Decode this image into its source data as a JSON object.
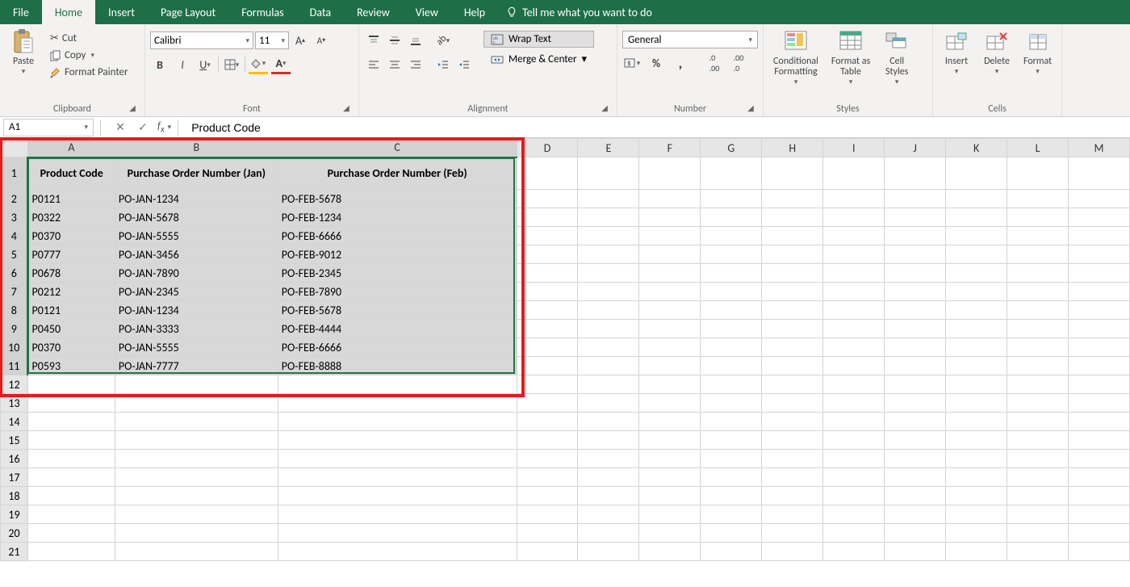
{
  "tabs": {
    "file": "File",
    "home": "Home",
    "insert": "Insert",
    "page_layout": "Page Layout",
    "formulas": "Formulas",
    "data": "Data",
    "review": "Review",
    "view": "View",
    "help": "Help",
    "tell_me": "Tell me what you want to do"
  },
  "clipboard": {
    "paste": "Paste",
    "cut": "Cut",
    "copy": "Copy",
    "format_painter": "Format Painter",
    "group": "Clipboard"
  },
  "font": {
    "name": "Calibri",
    "size": "11",
    "group": "Font"
  },
  "alignment": {
    "wrap": "Wrap Text",
    "merge": "Merge & Center",
    "group": "Alignment"
  },
  "number": {
    "format": "General",
    "group": "Number"
  },
  "styles": {
    "cond": "Conditional\nFormatting",
    "table": "Format as\nTable",
    "cell": "Cell\nStyles",
    "group": "Styles"
  },
  "cells": {
    "insert": "Insert",
    "delete": "Delete",
    "format": "Format",
    "group": "Cells"
  },
  "namebox": "A1",
  "formula_value": "Product Code",
  "columns": [
    "A",
    "B",
    "C",
    "D",
    "E",
    "F",
    "G",
    "H",
    "I",
    "J",
    "K",
    "L",
    "M"
  ],
  "row_count": 21,
  "table": {
    "headers": [
      "Product Code",
      "Purchase Order Number (Jan)",
      "Purchase Order Number (Feb)"
    ],
    "rows": [
      [
        "P0121",
        "PO-JAN-1234",
        "PO-FEB-5678"
      ],
      [
        "P0322",
        "PO-JAN-5678",
        "PO-FEB-1234"
      ],
      [
        "P0370",
        "PO-JAN-5555",
        "PO-FEB-6666"
      ],
      [
        "P0777",
        "PO-JAN-3456",
        "PO-FEB-9012"
      ],
      [
        "P0678",
        "PO-JAN-7890",
        "PO-FEB-2345"
      ],
      [
        "P0212",
        "PO-JAN-2345",
        "PO-FEB-7890"
      ],
      [
        "P0121",
        "PO-JAN-1234",
        "PO-FEB-5678"
      ],
      [
        "P0450",
        "PO-JAN-3333",
        "PO-FEB-4444"
      ],
      [
        "P0370",
        "PO-JAN-5555",
        "PO-FEB-6666"
      ],
      [
        "P0593",
        "PO-JAN-7777",
        "PO-FEB-8888"
      ]
    ]
  },
  "selection": {
    "range": "A1:C11"
  },
  "highlight_box": {
    "range": "A1:C12",
    "color": "#e81a1a"
  }
}
